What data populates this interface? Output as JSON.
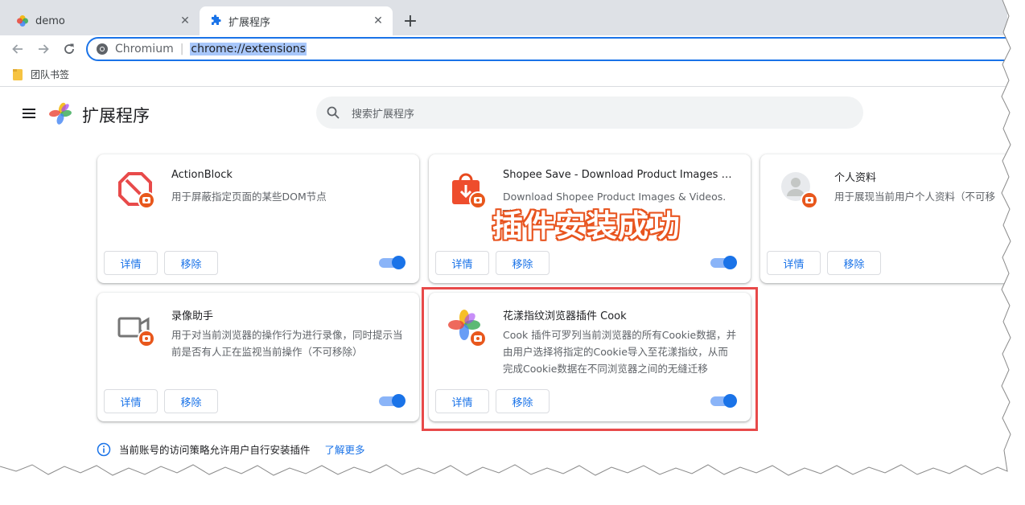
{
  "tabs": [
    {
      "title": "demo",
      "active": false,
      "favicon": "flower-icon"
    },
    {
      "title": "扩展程序",
      "active": true,
      "favicon": "puzzle-icon"
    }
  ],
  "toolbar": {
    "origin": "Chromium",
    "url": "chrome://extensions"
  },
  "bookmarks": [
    {
      "label": "团队书签",
      "icon": "folder-icon"
    }
  ],
  "header": {
    "title": "扩展程序",
    "search_placeholder": "搜索扩展程序"
  },
  "extensions": [
    {
      "name": "ActionBlock",
      "description": "用于屏蔽指定页面的某些DOM节点",
      "icon": "block-icon",
      "enabled": true,
      "details_label": "详情",
      "remove_label": "移除"
    },
    {
      "name": "Shopee Save - Download Product Images & Vid…",
      "description": "Download Shopee Product Images & Videos. The",
      "icon": "shopping-bag-download-icon",
      "enabled": true,
      "details_label": "详情",
      "remove_label": "移除"
    },
    {
      "name": "个人资料",
      "description": "用于展现当前用户个人资料（不可移",
      "icon": "avatar-icon",
      "enabled": true,
      "details_label": "详情",
      "remove_label": "移除"
    },
    {
      "name": "录像助手",
      "description": "用于对当前浏览器的操作行为进行录像，同时提示当前是否有人正在监视当前操作（不可移除）",
      "icon": "video-camera-icon",
      "enabled": true,
      "details_label": "详情",
      "remove_label": "移除"
    },
    {
      "name": "花漾指纹浏览器插件 Cook",
      "description": "Cook 插件可罗列当前浏览器的所有Cookie数据，并由用户选择将指定的Cookie导入至花漾指纹，从而完成Cookie数据在不同浏览器之间的无缝迁移",
      "icon": "flower-icon",
      "enabled": true,
      "details_label": "详情",
      "remove_label": "移除"
    }
  ],
  "overlay": {
    "text": "插件安装成功",
    "color": "#e8541f"
  },
  "policy": {
    "text": "当前账号的访问策略允许用户自行安装插件",
    "link": "了解更多"
  },
  "colors": {
    "accent": "#1a73e8",
    "badge": "#e8571c",
    "highlight_border": "#e84a4a"
  }
}
